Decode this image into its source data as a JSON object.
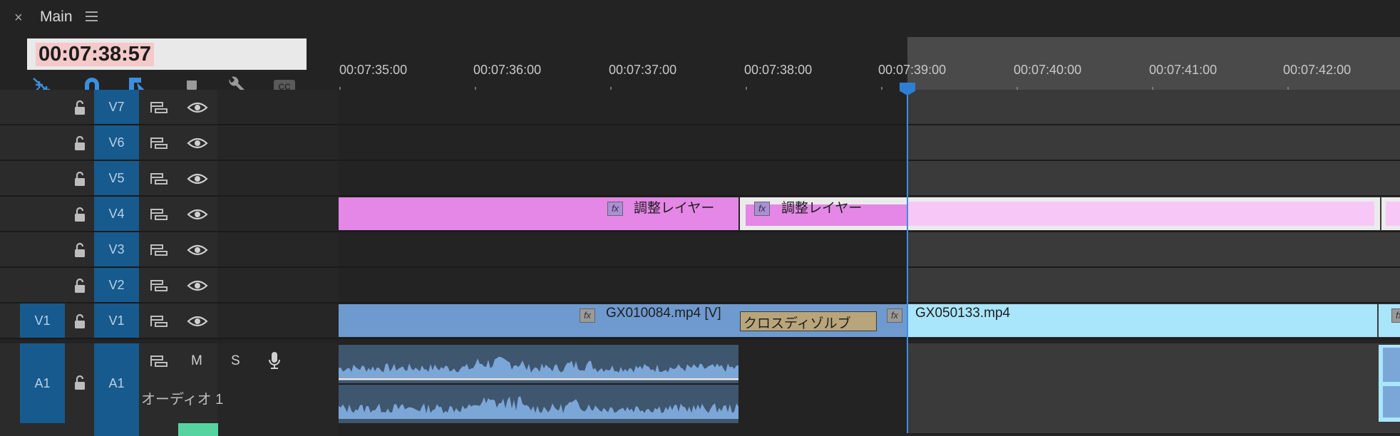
{
  "panel": {
    "close_glyph": "×",
    "title": "Main",
    "menu_icon": "hamburger-icon"
  },
  "timecode": "00:07:38:57",
  "tools": [
    "snap-icon",
    "magnet-icon",
    "linked-selection-icon",
    "marker-icon",
    "wrench-icon",
    "captions-icon"
  ],
  "tools_captions_label": "CC",
  "ruler": {
    "labels": [
      "00:07:35:00",
      "00:07:36:00",
      "00:07:37:00",
      "00:07:38:00",
      "00:07:39:00",
      "00:07:40:00",
      "00:07:41:00",
      "00:07:42:00"
    ]
  },
  "tracks": {
    "video": [
      {
        "source": "",
        "target": "V7"
      },
      {
        "source": "",
        "target": "V6"
      },
      {
        "source": "",
        "target": "V5"
      },
      {
        "source": "",
        "target": "V4"
      },
      {
        "source": "",
        "target": "V3"
      },
      {
        "source": "",
        "target": "V2"
      },
      {
        "source": "V1",
        "target": "V1"
      }
    ],
    "audio": [
      {
        "source": "A1",
        "target": "A1",
        "mute": "M",
        "solo": "S",
        "name": "オーディオ 1"
      }
    ]
  },
  "clips": {
    "adjustment_1": {
      "label": "調整レイヤー",
      "fx": "fx"
    },
    "adjustment_2": {
      "label": "調整レイヤー",
      "fx": "fx"
    },
    "video_1": {
      "label": "GX010084.mp4 [V]",
      "fx": "fx"
    },
    "transition": {
      "label": "クロスディゾルブ",
      "fx": "fx"
    },
    "video_2": {
      "label": "GX050133.mp4"
    },
    "edge_fx": "fx"
  },
  "colors": {
    "track_blue": "#165a8e",
    "adjustment_pink": "#e487e6",
    "adjustment_light": "#f7c8f7",
    "video_blue": "#6f9ad0",
    "video_light": "#a9e5fb",
    "playhead": "#2d7fd6",
    "workarea_yellow": "#e3b21a",
    "workarea_green": "#3bc45a"
  }
}
